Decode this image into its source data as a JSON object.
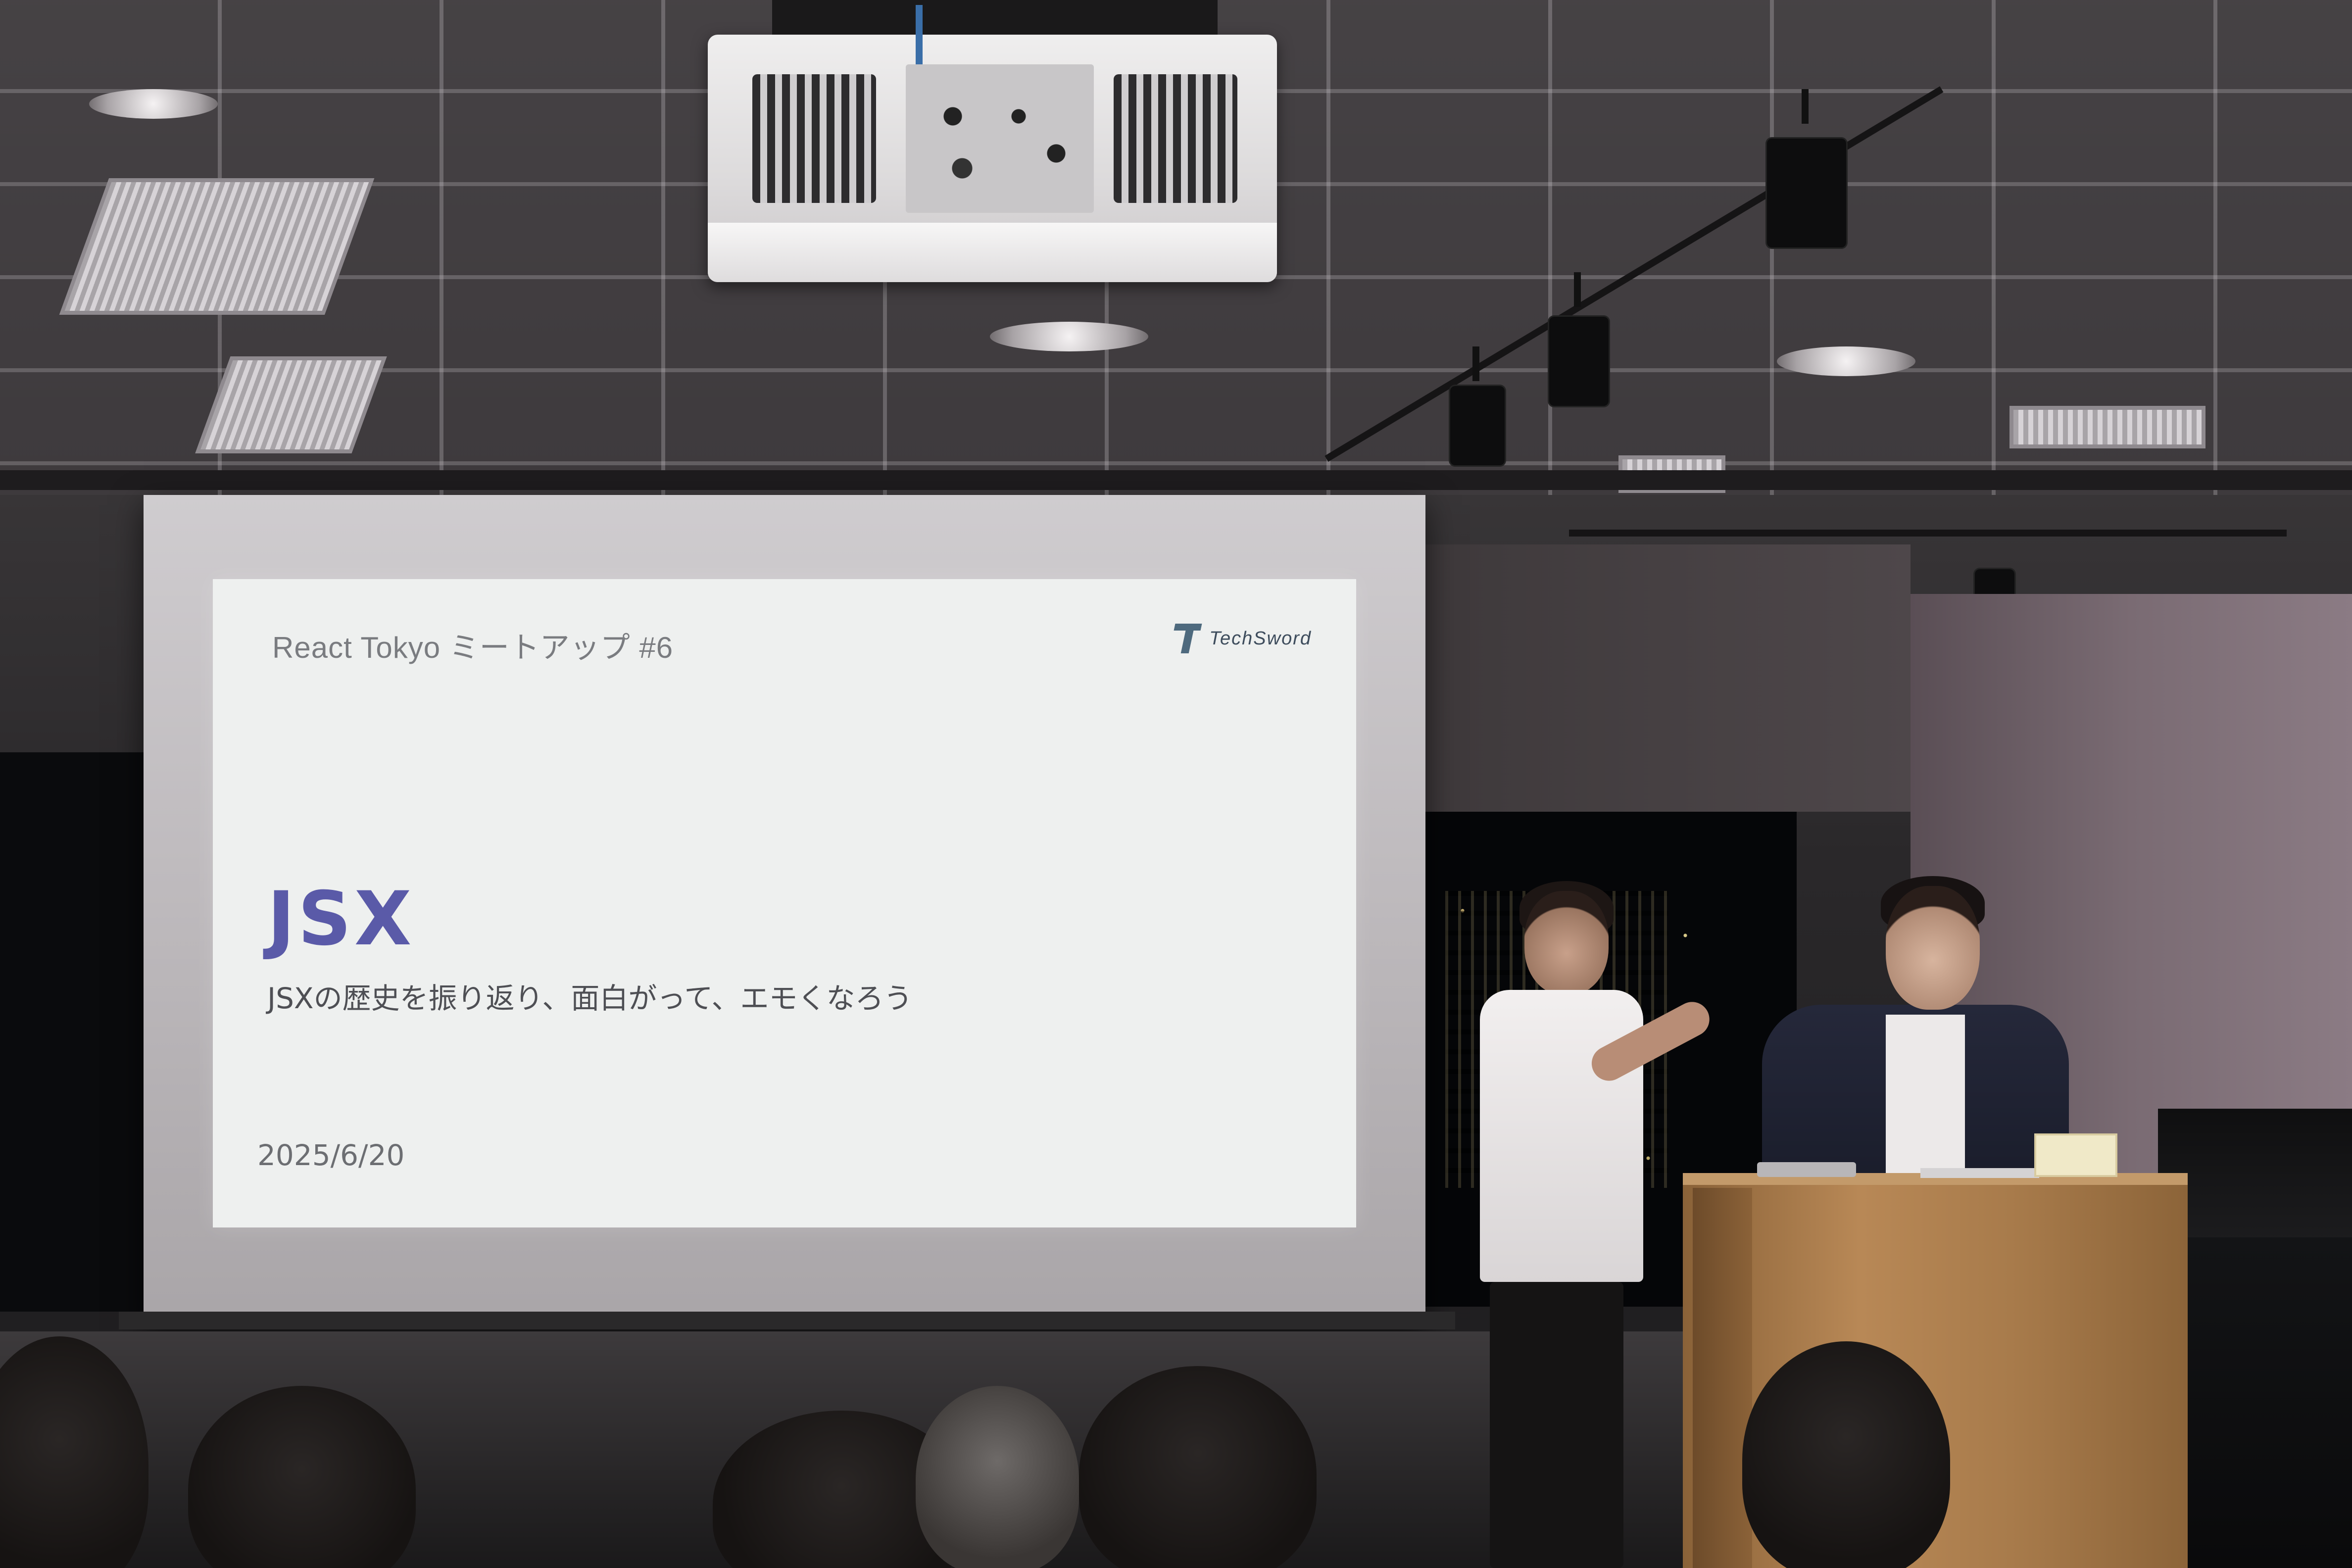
{
  "slide": {
    "header": "React Tokyo ミートアップ #6",
    "logo_text": "TechSword",
    "title": "JSX",
    "subtitle": "JSXの歴史を振り返り、面白がって、エモくなろう",
    "date": "2025/6/20"
  },
  "colors": {
    "slide_background": "#eef0ef",
    "title": "#5a5aa8",
    "subtitle": "#4e4f54",
    "header": "#7a7c80",
    "logo": "#3d4c5c"
  },
  "icons": {
    "logo": "techsword-logo-icon"
  }
}
